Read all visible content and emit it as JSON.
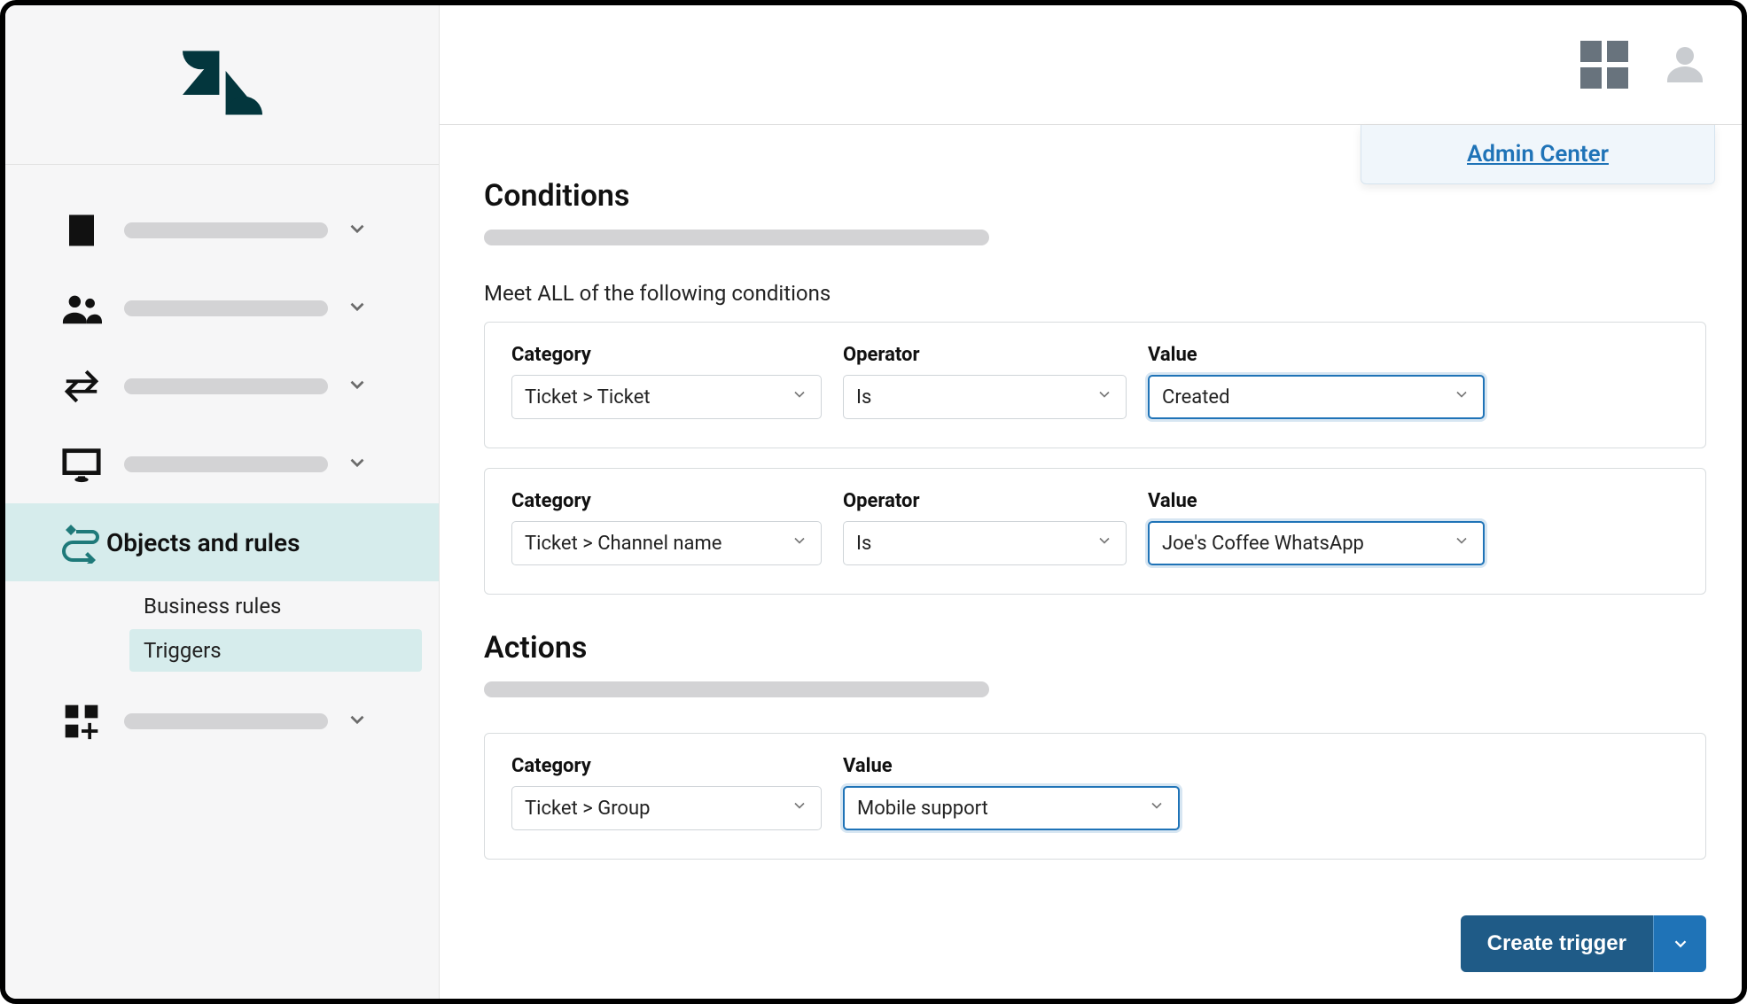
{
  "header": {
    "admin_center_label": "Admin Center"
  },
  "sidebar": {
    "active": {
      "label": "Objects and rules",
      "sub": [
        "Business rules",
        "Triggers"
      ],
      "active_sub_index": 1
    }
  },
  "conditions": {
    "title": "Conditions",
    "meet_all_label": "Meet ALL of the following conditions",
    "labels": {
      "category": "Category",
      "operator": "Operator",
      "value": "Value"
    },
    "rows": [
      {
        "category": "Ticket > Ticket",
        "operator": "Is",
        "value": "Created"
      },
      {
        "category": "Ticket > Channel name",
        "operator": "Is",
        "value": "Joe's Coffee WhatsApp"
      }
    ]
  },
  "actions": {
    "title": "Actions",
    "labels": {
      "category": "Category",
      "value": "Value"
    },
    "rows": [
      {
        "category": "Ticket > Group",
        "value": "Mobile support"
      }
    ]
  },
  "footer": {
    "create_label": "Create trigger"
  }
}
